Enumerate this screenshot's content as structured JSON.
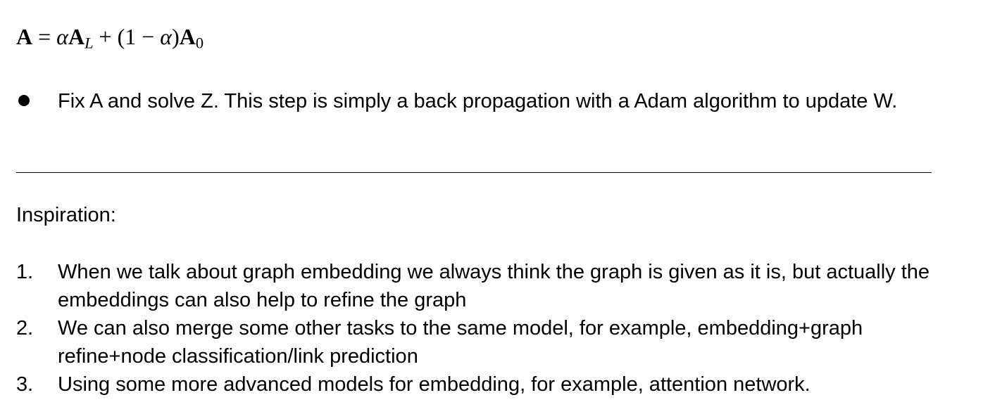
{
  "equation": {
    "lhs": "A",
    "equals": "=",
    "alpha1": "α",
    "term1": "A",
    "term1_sub": "L",
    "plus": "+",
    "paren_open": "(",
    "one": "1",
    "minus": "−",
    "alpha2": "α",
    "paren_close": ")",
    "term2": "A",
    "term2_sub": "0"
  },
  "bullet": {
    "text": "Fix A and solve Z. This step is simply a back propagation with a Adam algorithm to update W."
  },
  "inspiration": {
    "heading": "Inspiration:",
    "items": [
      {
        "marker": "1.",
        "text": "When we talk about graph embedding we always think the graph is given as it is, but actually the embeddings can also help to refine the graph"
      },
      {
        "marker": "2.",
        "text": "We can also merge some other tasks to the same model, for example, embedding+graph refine+node classification/link prediction"
      },
      {
        "marker": "3.",
        "text": "Using some more advanced models for embedding, for example, attention network."
      }
    ]
  }
}
